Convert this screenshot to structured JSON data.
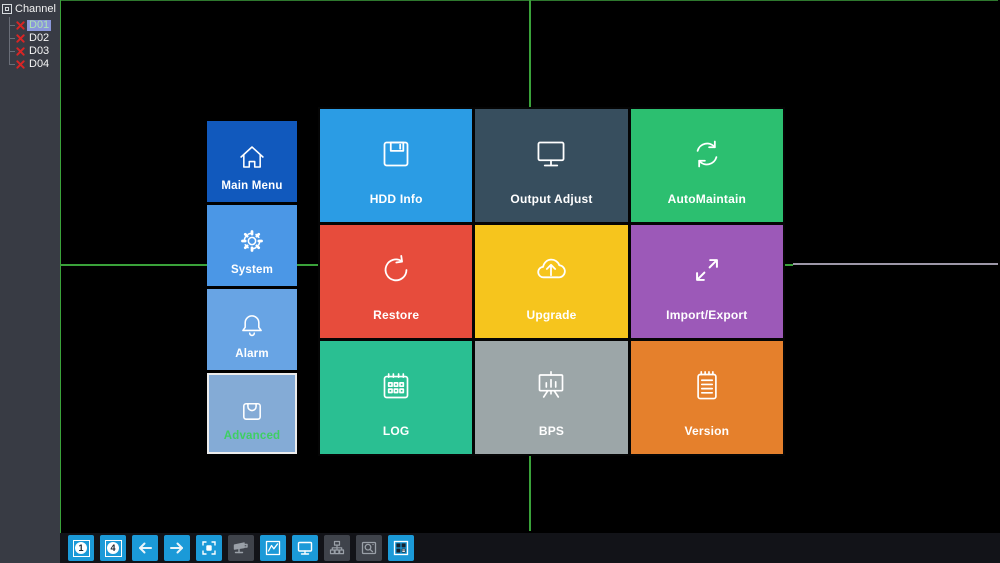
{
  "channel_panel": {
    "title": "Channel",
    "channels": [
      {
        "label": "D01",
        "status_icon": "x-offline-icon",
        "selected": true
      },
      {
        "label": "D02",
        "status_icon": "x-offline-icon",
        "selected": false
      },
      {
        "label": "D03",
        "status_icon": "x-offline-icon",
        "selected": false
      },
      {
        "label": "D04",
        "status_icon": "x-offline-icon",
        "selected": false
      }
    ]
  },
  "side_menu": {
    "items": [
      {
        "label": "Main Menu",
        "icon": "home-icon",
        "color": "#1159bd",
        "selected": false
      },
      {
        "label": "System",
        "icon": "gear-icon",
        "color": "#4b97e6",
        "selected": false
      },
      {
        "label": "Alarm",
        "icon": "bell-icon",
        "color": "#68a4e4",
        "selected": false
      },
      {
        "label": "Advanced",
        "icon": "bag-icon",
        "color": "#84abd6",
        "selected": true,
        "label_color": "#3ecf63"
      }
    ]
  },
  "menu_grid": {
    "tiles": [
      {
        "label": "HDD Info",
        "icon": "floppy-disk-icon",
        "color": "#2b9ce4"
      },
      {
        "label": "Output Adjust",
        "icon": "monitor-icon",
        "color": "#374e5e"
      },
      {
        "label": "AutoMaintain",
        "icon": "sync-icon",
        "color": "#2cbf70"
      },
      {
        "label": "Restore",
        "icon": "restore-icon",
        "color": "#e74c3c"
      },
      {
        "label": "Upgrade",
        "icon": "cloud-upload-icon",
        "color": "#f6c51d"
      },
      {
        "label": "Import/Export",
        "icon": "diagonal-arrows-icon",
        "color": "#9c59b8"
      },
      {
        "label": "LOG",
        "icon": "calendar-icon",
        "color": "#2abf92"
      },
      {
        "label": "BPS",
        "icon": "chart-board-icon",
        "color": "#9ca6a8"
      },
      {
        "label": "Version",
        "icon": "clipboard-icon",
        "color": "#e5802c"
      }
    ]
  },
  "taskbar": {
    "buttons": [
      {
        "name": "single-view",
        "icon": "view-1-icon",
        "badge": "1",
        "style": "blue"
      },
      {
        "name": "quad-view",
        "icon": "view-4-icon",
        "badge": "4",
        "style": "blue"
      },
      {
        "name": "prev-screen",
        "icon": "arrow-left-icon",
        "style": "blue"
      },
      {
        "name": "next-screen",
        "icon": "arrow-right-icon",
        "style": "blue"
      },
      {
        "name": "stop",
        "icon": "stop-icon",
        "style": "blue"
      },
      {
        "name": "ptz",
        "icon": "cctv-camera-icon",
        "style": "gray"
      },
      {
        "name": "color-adjust",
        "icon": "waveform-icon",
        "style": "blue"
      },
      {
        "name": "display",
        "icon": "monitor-icon",
        "style": "blue"
      },
      {
        "name": "network",
        "icon": "network-tree-icon",
        "style": "gray"
      },
      {
        "name": "storage",
        "icon": "hdd-search-icon",
        "style": "gray"
      },
      {
        "name": "layout-grid",
        "icon": "grid-layout-icon",
        "style": "blue"
      }
    ]
  },
  "colors": {
    "divider_green": "#3aa23a",
    "divider_gray": "#9d97a8",
    "panel_bg": "#383b44",
    "taskbar_blue": "#1b9ad8",
    "taskbar_gray": "#3f434b",
    "offline_red": "#d92525",
    "selected_channel_bg": "#8b98da",
    "advanced_label_green": "#3ecf63"
  }
}
